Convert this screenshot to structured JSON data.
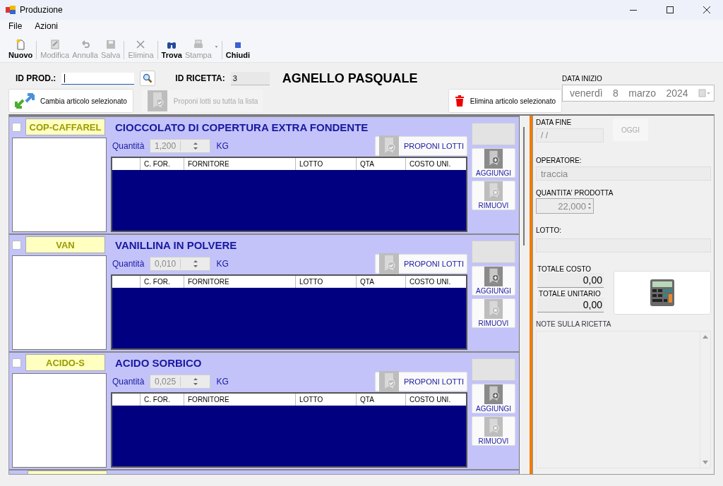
{
  "window": {
    "title": "Produzione"
  },
  "menu": [
    "File",
    "Azioni"
  ],
  "toolbar": [
    {
      "label": "Nuovo",
      "kind": "new",
      "disabled": false
    },
    {
      "label": "Modifica",
      "kind": "edit",
      "disabled": true
    },
    {
      "label": "Annulla",
      "kind": "undo",
      "disabled": true
    },
    {
      "label": "Salva",
      "kind": "save",
      "disabled": true
    },
    {
      "label": "Elimina",
      "kind": "delete",
      "disabled": true
    },
    {
      "label": "Trova",
      "kind": "find",
      "disabled": false
    },
    {
      "label": "Stampa",
      "kind": "print",
      "disabled": true
    },
    {
      "label": "Chiudi",
      "kind": "close",
      "disabled": false
    }
  ],
  "header": {
    "id_prod_label": "ID PROD.:",
    "id_ricetta_label": "ID RICETTA:",
    "id_ricetta": "3",
    "recipe_name": "AGNELLO PASQUALE",
    "change_button": {
      "label": "Cambia articolo selezionato",
      "disabled": false
    },
    "propose_all_button": {
      "label": "Proponi lotti su tutta la lista",
      "disabled": true
    },
    "delete_button": {
      "label": "Elimina articolo selezionato",
      "disabled": false
    },
    "start_date": {
      "label": "DATA INIZIO",
      "weekday": "venerdì",
      "day": "8",
      "month": "marzo",
      "year": "2024"
    }
  },
  "items": [
    {
      "code": "COP-CAFFAREL",
      "name": "CIOCCOLATO DI COPERTURA EXTRA FONDENTE",
      "checked": false,
      "quantity_label": "Quantità",
      "quantity": "1,200",
      "unit": "KG",
      "propose": "PROPONI LOTTI",
      "columns": [
        "C. FOR.",
        "FORNITORE",
        "LOTTO",
        "QTA",
        "COSTO UNI."
      ],
      "add": "AGGIUNGI",
      "remove": "RIMUOVI"
    },
    {
      "code": "VAN",
      "name": "VANILLINA IN POLVERE",
      "checked": false,
      "quantity_label": "Quantità",
      "quantity": "0,010",
      "unit": "KG",
      "propose": "PROPONI LOTTI",
      "columns": [
        "C. FOR.",
        "FORNITORE",
        "LOTTO",
        "QTA",
        "COSTO UNI."
      ],
      "add": "AGGIUNGI",
      "remove": "RIMUOVI"
    },
    {
      "code": "ACIDO-S",
      "name": "ACIDO SORBICO",
      "checked": false,
      "quantity_label": "Quantità",
      "quantity": "0,025",
      "unit": "KG",
      "propose": "PROPONI LOTTI",
      "columns": [
        "C. FOR.",
        "FORNITORE",
        "LOTTO",
        "QTA",
        "COSTO UNI."
      ],
      "add": "AGGIUNGI",
      "remove": "RIMUOVI"
    }
  ],
  "side": {
    "end_date_label": "DATA FINE",
    "end_date": "/ /",
    "today_button": {
      "label": "OGGI",
      "disabled": true
    },
    "operator_label": "OPERATORE:",
    "operator": "traccia",
    "produced_label": "QUANTITA' PRODOTTA",
    "produced": "22,000",
    "lot_label": "LOTTO:",
    "total_cost_label": "TOTALE COSTO",
    "total_cost": "0,00",
    "unit_total_label": "TOTALE UNITARIO",
    "unit_total": "0,00",
    "notes_label": "NOTE SULLA RICETTA"
  }
}
